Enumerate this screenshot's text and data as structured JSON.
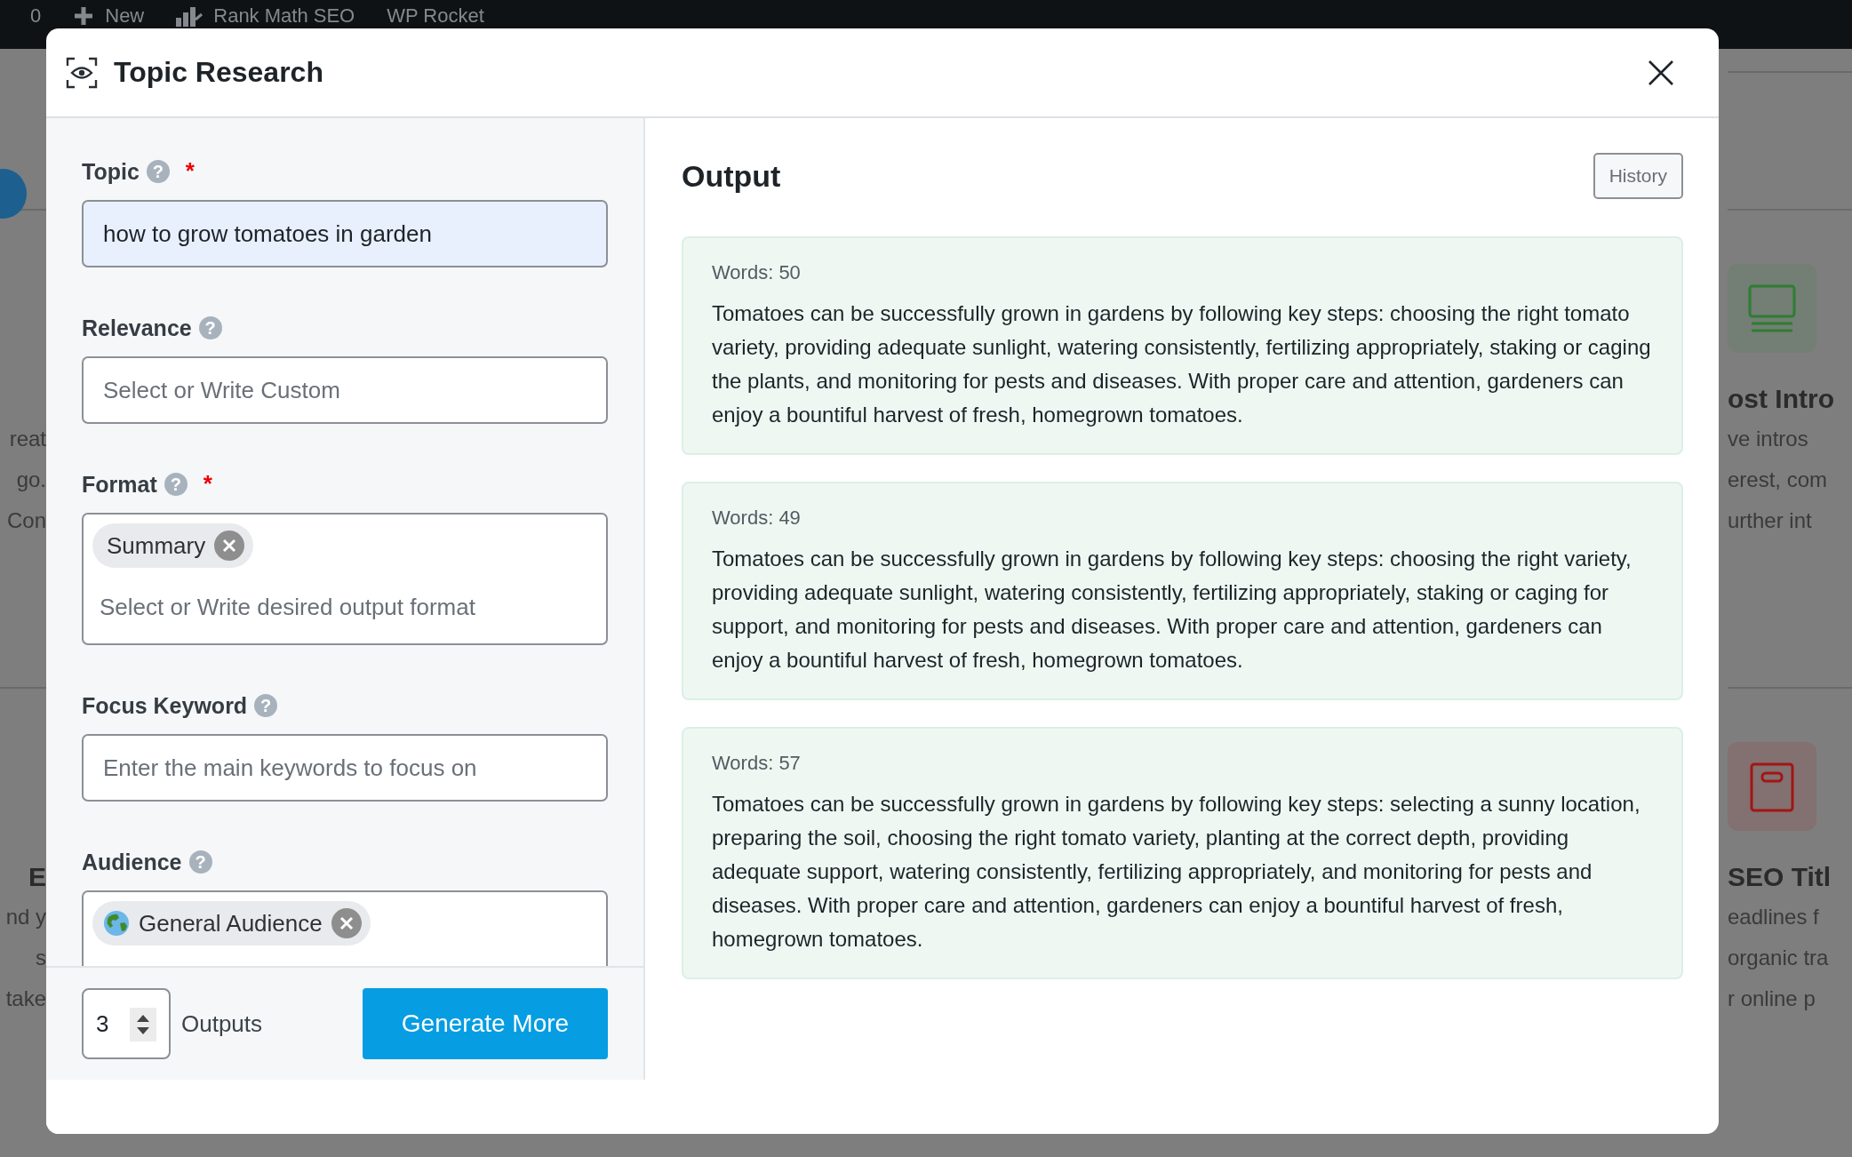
{
  "admin_bar": {
    "items": [
      {
        "kind": "count",
        "label": "0"
      },
      {
        "kind": "new",
        "label": "New"
      },
      {
        "kind": "seo",
        "label": "Rank Math SEO"
      },
      {
        "kind": "plain",
        "label": "WP Rocket"
      }
    ]
  },
  "background": {
    "left_cards": [
      {
        "lines": [
          "reat",
          "go.",
          "Con"
        ]
      },
      {
        "title": "E",
        "lines": [
          "nd y",
          "s",
          "take"
        ]
      }
    ],
    "right_cards": [
      {
        "color": "#2e7d32",
        "title": "ost Intro",
        "lines": [
          "ve intros",
          "erest, com",
          "urther int"
        ]
      },
      {
        "color": "#a31515",
        "title": "SEO Titl",
        "lines": [
          "eadlines f",
          "organic tra",
          "r online p"
        ]
      }
    ]
  },
  "modal": {
    "title": "Topic Research",
    "fields": [
      {
        "kind": "text",
        "label": "Topic",
        "help": "?",
        "required_mark": "*",
        "value": "how to grow tomatoes in garden",
        "autofilled": true
      },
      {
        "kind": "text",
        "label": "Relevance",
        "help": "?",
        "placeholder": "Select or Write Custom",
        "autofilled": false
      },
      {
        "kind": "tags",
        "label": "Format",
        "help": "?",
        "required_mark": "*",
        "tags": [
          {
            "kind": "plain",
            "label": "Summary"
          }
        ],
        "placeholder": "Select or Write desired output format"
      },
      {
        "kind": "text",
        "label": "Focus Keyword",
        "help": "?",
        "placeholder": "Enter the main keywords to focus on",
        "autofilled": false
      },
      {
        "kind": "tags",
        "label": "Audience",
        "help": "?",
        "tags": [
          {
            "kind": "globe",
            "label": "General Audience"
          }
        ]
      }
    ],
    "outputs_count": "3",
    "outputs_label": "Outputs",
    "generate_button": "Generate More"
  },
  "output": {
    "title": "Output",
    "history_button": "History",
    "results": [
      {
        "words": "Words: 50",
        "text": "Tomatoes can be successfully grown in gardens by following key steps: choosing the right tomato variety, providing adequate sunlight, watering consistently, fertilizing appropriately, staking or caging the plants, and monitoring for pests and diseases. With proper care and attention, gardeners can enjoy a bountiful harvest of fresh, homegrown tomatoes."
      },
      {
        "words": "Words: 49",
        "text": "Tomatoes can be successfully grown in gardens by following key steps: choosing the right variety, providing adequate sunlight, watering consistently, fertilizing appropriately, staking or caging for support, and monitoring for pests and diseases. With proper care and attention, gardeners can enjoy a bountiful harvest of fresh, homegrown tomatoes."
      },
      {
        "words": "Words: 57",
        "text": "Tomatoes can be successfully grown in gardens by following key steps: selecting a sunny location, preparing the soil, choosing the right tomato variety, planting at the correct depth, providing adequate support, watering consistently, fertilizing appropriately, and monitoring for pests and diseases. With proper care and attention, gardeners can enjoy a bountiful harvest of fresh, homegrown tomatoes."
      }
    ]
  }
}
